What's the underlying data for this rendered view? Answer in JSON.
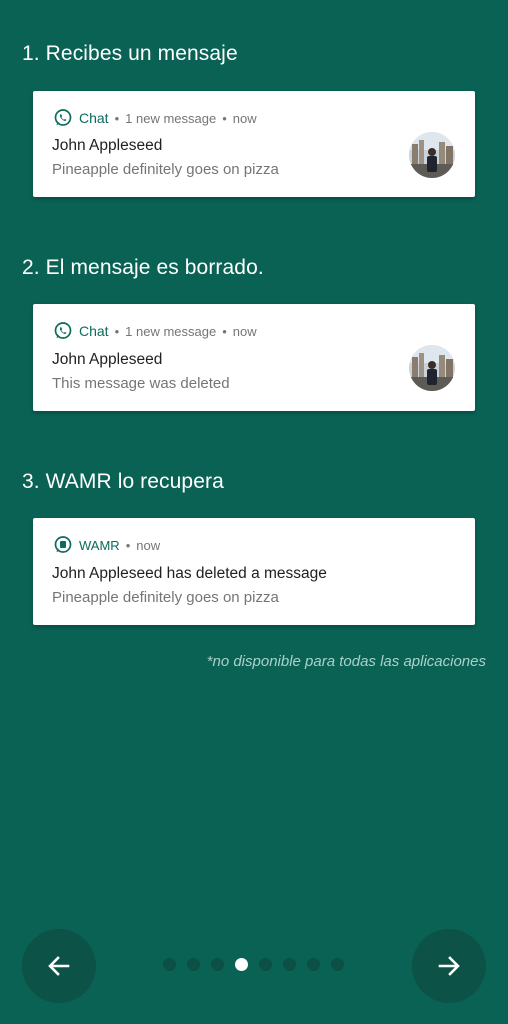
{
  "steps": [
    {
      "title": "1. Recibes un mensaje"
    },
    {
      "title": "2. El mensaje es borrado."
    },
    {
      "title": "3. WAMR lo recupera"
    }
  ],
  "cards": [
    {
      "app": "Chat",
      "meta": "1 new message",
      "time": "now",
      "title": "John Appleseed",
      "text": "Pineapple definitely goes on pizza"
    },
    {
      "app": "Chat",
      "meta": "1 new message",
      "time": "now",
      "title": "John Appleseed",
      "text": "This message was deleted"
    },
    {
      "app": "WAMR",
      "time": "now",
      "title": "John Appleseed has deleted a message",
      "text": "Pineapple definitely goes on pizza"
    }
  ],
  "note": "*no disponible para todas las aplicaciones",
  "pager": {
    "count": 8,
    "active_index": 3
  },
  "nav": {
    "back_icon": "arrow-left-icon",
    "next_icon": "arrow-right-icon"
  },
  "colors": {
    "background": "#0a6255",
    "accent": "#0b6b5e",
    "button": "#0c5246"
  }
}
